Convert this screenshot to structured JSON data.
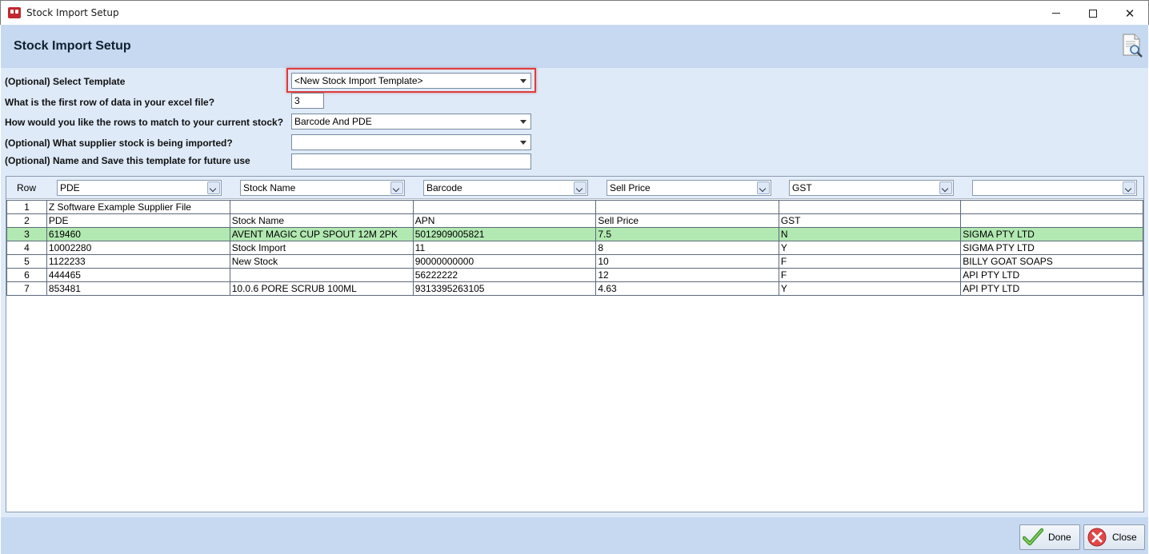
{
  "window": {
    "title": "Stock Import Setup"
  },
  "header": {
    "title": "Stock Import Setup"
  },
  "form": {
    "template_label": "(Optional) Select Template",
    "template_value": "<New Stock Import Template>",
    "first_row_label": "What is the first row of data in your excel file?",
    "first_row_value": "3",
    "match_label": "How would you like the rows to match to your current stock?",
    "match_value": "Barcode And PDE",
    "supplier_label": "(Optional) What supplier stock is being imported?",
    "supplier_value": "",
    "save_name_label": "(Optional) Name and Save this template for future use",
    "save_name_value": ""
  },
  "grid": {
    "row_header": "Row",
    "column_mappings": [
      "PDE",
      "Stock Name",
      "Barcode",
      "Sell Price",
      "GST",
      ""
    ],
    "selected_row": 3,
    "rows": [
      {
        "n": "1",
        "cells": [
          "Z Software Example Supplier File",
          "",
          "",
          "",
          "",
          ""
        ]
      },
      {
        "n": "2",
        "cells": [
          "PDE",
          "Stock Name",
          "APN",
          "Sell Price",
          "GST",
          ""
        ]
      },
      {
        "n": "3",
        "cells": [
          "619460",
          "AVENT MAGIC CUP SPOUT 12M 2PK",
          "5012909005821",
          "7.5",
          "N",
          "SIGMA PTY LTD"
        ]
      },
      {
        "n": "4",
        "cells": [
          "10002280",
          "Stock Import",
          "11",
          "8",
          "Y",
          "SIGMA PTY LTD"
        ]
      },
      {
        "n": "5",
        "cells": [
          "1122233",
          "New Stock",
          "90000000000",
          "10",
          "F",
          "BILLY GOAT SOAPS"
        ]
      },
      {
        "n": "6",
        "cells": [
          "444465",
          "",
          "56222222",
          "12",
          "F",
          "API PTY LTD"
        ]
      },
      {
        "n": "7",
        "cells": [
          "853481",
          "10.0.6 PORE SCRUB 100ML",
          "9313395263105",
          "4.63",
          "Y",
          "API PTY LTD"
        ]
      }
    ]
  },
  "footer": {
    "done_label": "Done",
    "close_label": "Close"
  },
  "colors": {
    "header_band": "#c6d9f0",
    "form_bg": "#dfeaf8",
    "selected_row": "#b2e8b2",
    "highlight_border": "#e03c3c"
  }
}
